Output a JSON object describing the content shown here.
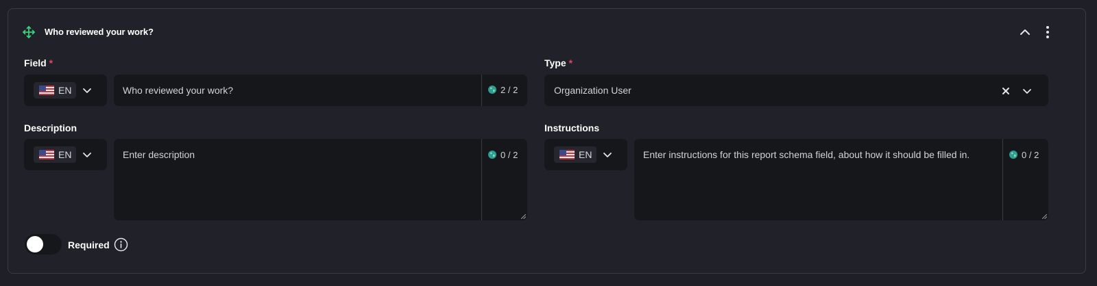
{
  "card": {
    "title": "Who reviewed your work?",
    "icons": {
      "drag": "move-icon",
      "collapse": "chevron-up-icon",
      "menu": "more-vertical-icon"
    }
  },
  "field": {
    "label": "Field",
    "required_mark": "*",
    "lang_code": "EN",
    "value": "Who reviewed your work?",
    "counter": "2 / 2"
  },
  "type": {
    "label": "Type",
    "required_mark": "*",
    "value": "Organization User"
  },
  "description": {
    "label": "Description",
    "lang_code": "EN",
    "placeholder": "Enter description",
    "counter": "0 / 2"
  },
  "instructions": {
    "label": "Instructions",
    "lang_code": "EN",
    "placeholder": "Enter instructions for this report schema field, about how it should be filled in.",
    "counter": "0 / 2"
  },
  "required_toggle": {
    "label": "Required",
    "on": false
  },
  "colors": {
    "background": "#1f2027",
    "input_bg": "#16171b",
    "accent_green": "#3ecf7a",
    "required_red": "#e0475b"
  }
}
